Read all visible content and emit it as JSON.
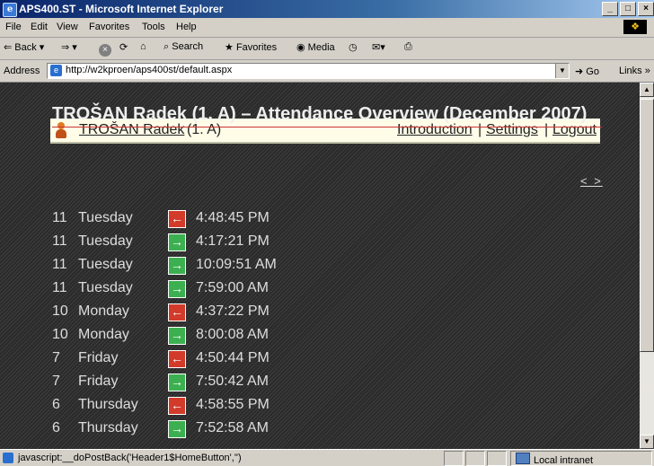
{
  "window": {
    "title": "APS400.ST - Microsoft Internet Explorer",
    "min": "_",
    "max": "□",
    "close": "×"
  },
  "menu": [
    "File",
    "Edit",
    "View",
    "Favorites",
    "Tools",
    "Help"
  ],
  "toolbar": {
    "back": "Back",
    "search": "Search",
    "favorites": "Favorites",
    "media": "Media"
  },
  "address": {
    "label": "Address",
    "url": "http://w2kproen/aps400st/default.aspx",
    "go": "Go",
    "links": "Links"
  },
  "header": {
    "user": "TROŠAN Radek",
    "class": "(1. A)",
    "nav": {
      "introduction": "Introduction",
      "sep": "|",
      "settings": "Settings",
      "logout": "Logout"
    }
  },
  "page": {
    "title": "TROŠAN Radek (1. A) – Attendance Overview (December 2007)",
    "pager": "< >"
  },
  "records": [
    {
      "day": "11",
      "weekday": "Tuesday",
      "dir": "out",
      "time": "4:48:45 PM"
    },
    {
      "day": "11",
      "weekday": "Tuesday",
      "dir": "in",
      "time": "4:17:21 PM"
    },
    {
      "day": "11",
      "weekday": "Tuesday",
      "dir": "in",
      "time": "10:09:51 AM"
    },
    {
      "day": "11",
      "weekday": "Tuesday",
      "dir": "in",
      "time": "7:59:00 AM"
    },
    {
      "day": "10",
      "weekday": "Monday",
      "dir": "out",
      "time": "4:37:22 PM"
    },
    {
      "day": "10",
      "weekday": "Monday",
      "dir": "in",
      "time": "8:00:08 AM"
    },
    {
      "day": "7",
      "weekday": "Friday",
      "dir": "out",
      "time": "4:50:44 PM"
    },
    {
      "day": "7",
      "weekday": "Friday",
      "dir": "in",
      "time": "7:50:42 AM"
    },
    {
      "day": "6",
      "weekday": "Thursday",
      "dir": "out",
      "time": "4:58:55 PM"
    },
    {
      "day": "6",
      "weekday": "Thursday",
      "dir": "in",
      "time": "7:52:58 AM"
    }
  ],
  "status": {
    "text": "javascript:__doPostBack('Header1$HomeButton','')",
    "zone": "Local intranet"
  }
}
